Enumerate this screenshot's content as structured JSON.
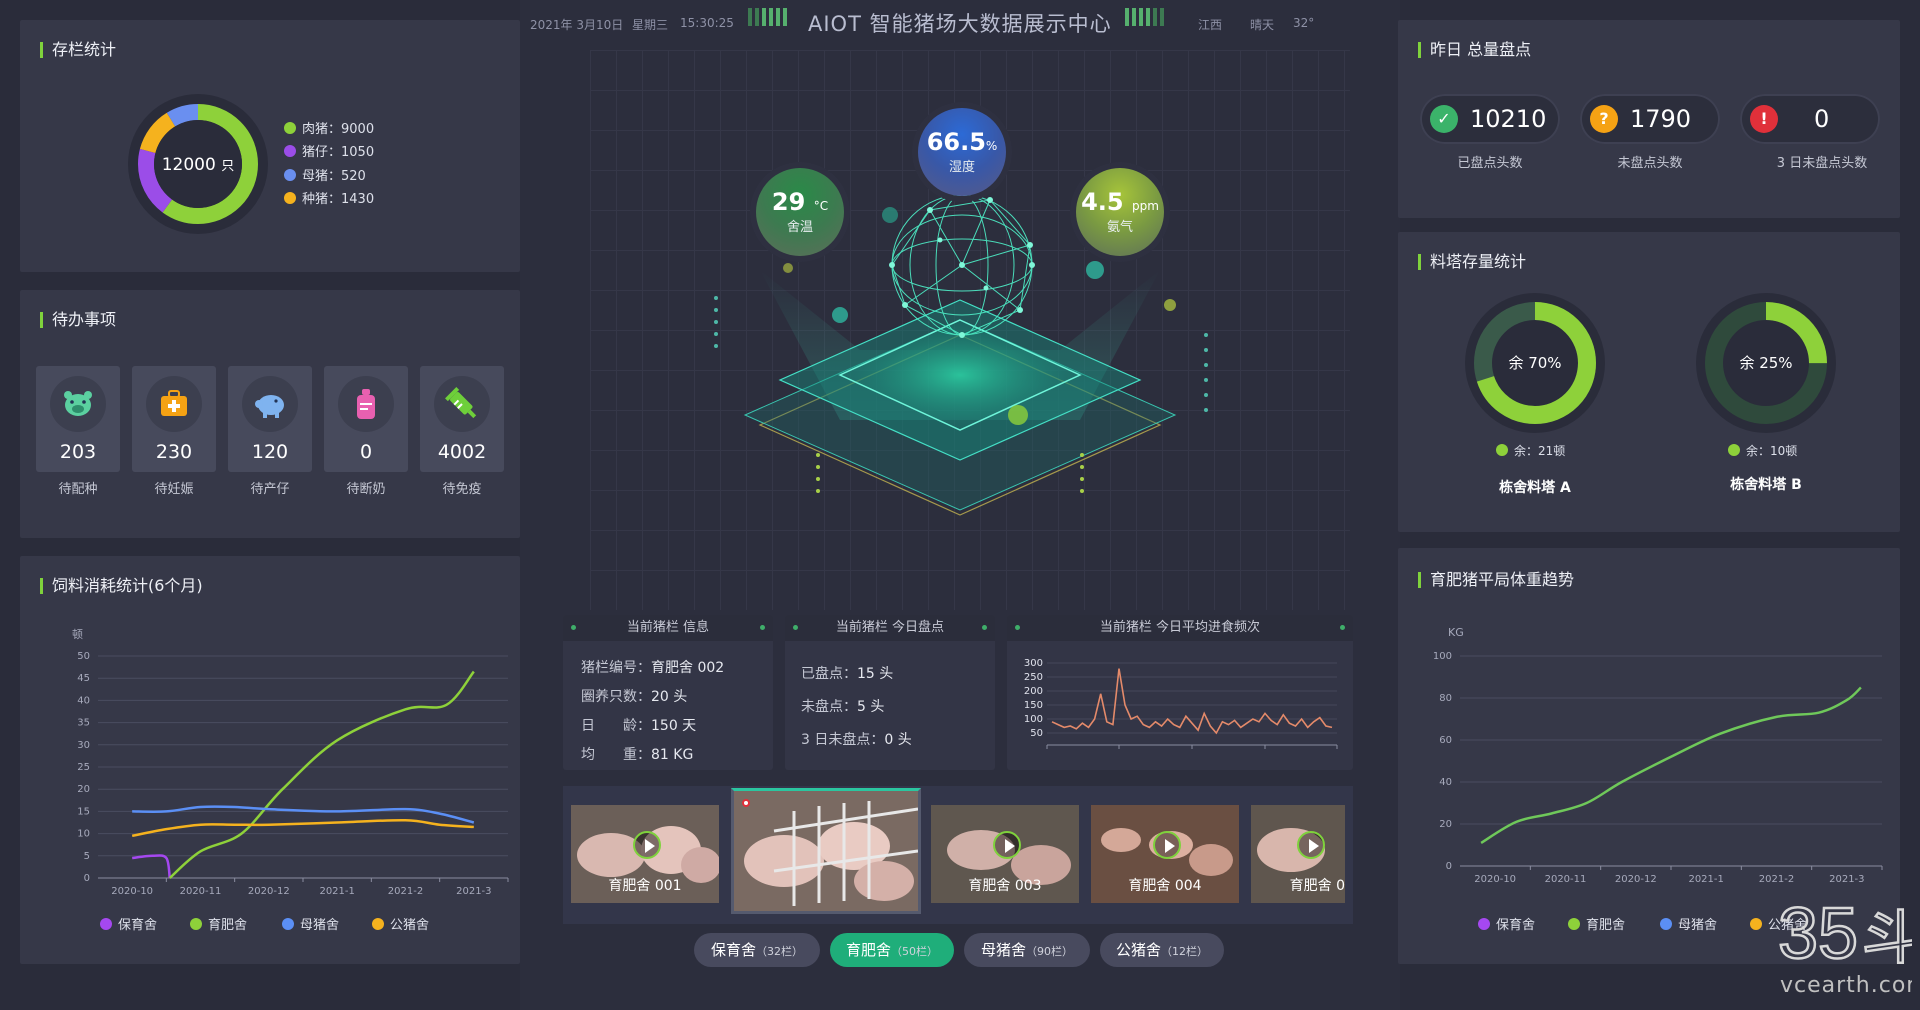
{
  "header": {
    "date": "2021年 3月10日",
    "weekday": "星期三",
    "time": "15:30:25",
    "title": "AIOT 智能猪场大数据展示中心",
    "location": "江西",
    "weather": "晴天",
    "temperature": "32°"
  },
  "inventory": {
    "title": "存栏统计",
    "total": "12000",
    "unit": "只",
    "items": [
      {
        "label": "肉猪：9000",
        "color": "#8ed13a"
      },
      {
        "label": "猪仔：1050",
        "color": "#9b4de8"
      },
      {
        "label": "母猪：520",
        "color": "#6a8ff0"
      },
      {
        "label": "种猪：1430",
        "color": "#f5b21e"
      }
    ]
  },
  "todo": {
    "title": "待办事项",
    "items": [
      {
        "value": "203",
        "label": "待配种",
        "icon": "pig-face-icon"
      },
      {
        "value": "230",
        "label": "待妊娠",
        "icon": "medical-kit-icon"
      },
      {
        "value": "120",
        "label": "待产仔",
        "icon": "piggy-icon"
      },
      {
        "value": "0",
        "label": "待断奶",
        "icon": "baby-bottle-icon"
      },
      {
        "value": "4002",
        "label": "待免疫",
        "icon": "syringe-icon"
      }
    ]
  },
  "feed_chart": {
    "title": "饲料消耗统计(6个月)",
    "unit": "顿",
    "legend": [
      {
        "label": "保育舍",
        "color": "#a548f0"
      },
      {
        "label": "育肥舍",
        "color": "#8ed13a"
      },
      {
        "label": "母猪舍",
        "color": "#5b8ff5"
      },
      {
        "label": "公猪舍",
        "color": "#f5b21e"
      }
    ]
  },
  "weight_chart": {
    "title": "育肥猪平局体重趋势",
    "unit": "KG",
    "legend": [
      {
        "label": "保育舍",
        "color": "#a548f0"
      },
      {
        "label": "育肥舍",
        "color": "#8ed13a"
      },
      {
        "label": "母猪舍",
        "color": "#5b8ff5"
      },
      {
        "label": "公猪舍",
        "color": "#f5b21e"
      }
    ]
  },
  "env": {
    "temp": {
      "value": "29",
      "unit": "°C",
      "label": "舍温"
    },
    "humidity": {
      "value": "66.5",
      "unit": "%",
      "label": "湿度"
    },
    "ammonia": {
      "value": "4.5",
      "unit": "ppm",
      "label": "氨气"
    }
  },
  "pen_info": {
    "title": "当前猪栏 信息",
    "rows": [
      {
        "k": "猪栏编号：",
        "v": "育肥舍 002"
      },
      {
        "k": "圈养只数：",
        "v": "20 头"
      },
      {
        "k": "日　　龄：",
        "v": "150 天"
      },
      {
        "k": "均　　重：",
        "v": "81 KG"
      }
    ]
  },
  "pen_count": {
    "title": "当前猪栏 今日盘点",
    "rows": [
      {
        "k": "已盘点：",
        "v": "15 头"
      },
      {
        "k": "未盘点：",
        "v": "5 头"
      },
      {
        "k": "3 日未盘点：",
        "v": "0 头"
      }
    ]
  },
  "feed_freq": {
    "title": "当前猪栏 今日平均进食频次",
    "y_ticks": [
      "300",
      "250",
      "200",
      "150",
      "100",
      "50"
    ]
  },
  "cameras": [
    {
      "label": "育肥舍 001",
      "selected": false
    },
    {
      "label": "",
      "selected": true
    },
    {
      "label": "育肥舍 003",
      "selected": false
    },
    {
      "label": "育肥舍 004",
      "selected": false
    },
    {
      "label": "育肥舍 0",
      "selected": false
    }
  ],
  "tabs": [
    {
      "name": "保育舍",
      "count": "（32栏）",
      "active": false
    },
    {
      "name": "育肥舍",
      "count": "（50栏）",
      "active": true
    },
    {
      "name": "母猪舍",
      "count": "（90栏）",
      "active": false
    },
    {
      "name": "公猪舍",
      "count": "（12栏）",
      "active": false
    }
  ],
  "total_count": {
    "title": "昨日 总量盘点",
    "items": [
      {
        "value": "10210",
        "label": "已盘点头数",
        "color": "#3bb36a",
        "icon": "check-icon",
        "glyph": "✓"
      },
      {
        "value": "1790",
        "label": "未盘点头数",
        "color": "#f5a214",
        "icon": "question-icon",
        "glyph": "?"
      },
      {
        "value": "0",
        "label": "3 日未盘点头数",
        "color": "#e0303a",
        "icon": "warning-icon",
        "glyph": "!"
      }
    ]
  },
  "silo": {
    "title": "料塔存量统计",
    "items": [
      {
        "pct_label": "余 70%",
        "fraction": 0.7,
        "remain": "余：21顿",
        "name": "栋舍料塔 A"
      },
      {
        "pct_label": "余 25%",
        "fraction": 0.25,
        "remain": "余：10顿",
        "name": "栋舍料塔 B"
      }
    ]
  },
  "chart_data": [
    {
      "type": "line",
      "title": "饲料消耗统计(6个月)",
      "ylabel": "顿",
      "x": [
        "2020-10",
        "2020-11",
        "2020-12",
        "2021-1",
        "2021-2",
        "2021-3"
      ],
      "ylim": [
        0,
        50
      ],
      "yticks": [
        0,
        5,
        10,
        15,
        20,
        25,
        30,
        35,
        40,
        45,
        50
      ],
      "series": [
        {
          "name": "保育舍",
          "color": "#a548f0",
          "points": [
            [
              0,
              4.5
            ],
            [
              0.3,
              5
            ],
            [
              0.5,
              4.5
            ],
            [
              0.55,
              0
            ]
          ]
        },
        {
          "name": "育肥舍",
          "color": "#8ed13a",
          "points": [
            [
              0.55,
              0
            ],
            [
              1,
              6
            ],
            [
              1.6,
              10
            ],
            [
              2.2,
              20
            ],
            [
              3,
              31
            ],
            [
              4,
              38
            ],
            [
              4.6,
              39
            ],
            [
              5,
              46.5
            ]
          ]
        },
        {
          "name": "母猪舍",
          "color": "#5b8ff5",
          "points": [
            [
              0,
              15
            ],
            [
              0.5,
              15
            ],
            [
              1,
              16
            ],
            [
              1.5,
              16
            ],
            [
              2,
              15.5
            ],
            [
              3,
              15
            ],
            [
              4,
              15.5
            ],
            [
              4.5,
              14.5
            ],
            [
              5,
              12.5
            ]
          ]
        },
        {
          "name": "公猪舍",
          "color": "#f5b21e",
          "points": [
            [
              0,
              9.5
            ],
            [
              0.5,
              11
            ],
            [
              1,
              12
            ],
            [
              1.5,
              12
            ],
            [
              2,
              12
            ],
            [
              3,
              12.5
            ],
            [
              4,
              13
            ],
            [
              4.5,
              12
            ],
            [
              5,
              11.5
            ]
          ]
        }
      ]
    },
    {
      "type": "line",
      "title": "育肥猪平局体重趋势",
      "ylabel": "KG",
      "x": [
        "2020-10",
        "2020-11",
        "2020-12",
        "2021-1",
        "2021-2",
        "2021-3"
      ],
      "ylim": [
        0,
        100
      ],
      "yticks": [
        0,
        20,
        40,
        60,
        80,
        100
      ],
      "series": [
        {
          "name": "育肥舍",
          "color": "#6fc85a",
          "points": [
            [
              -0.2,
              11
            ],
            [
              0.3,
              21
            ],
            [
              0.8,
              25
            ],
            [
              1.3,
              30
            ],
            [
              1.8,
              40
            ],
            [
              2.5,
              52
            ],
            [
              3.2,
              63
            ],
            [
              4,
              71
            ],
            [
              4.6,
              73
            ],
            [
              5,
              79
            ],
            [
              5.2,
              85
            ]
          ]
        }
      ]
    },
    {
      "type": "line",
      "title": "当前猪栏 今日平均进食频次",
      "ylim": [
        50,
        300
      ],
      "yticks": [
        50,
        100,
        150,
        200,
        250,
        300
      ],
      "series": [
        {
          "name": "",
          "color": "#e48a6a",
          "values": [
            90,
            80,
            70,
            75,
            65,
            85,
            70,
            100,
            190,
            90,
            80,
            280,
            150,
            100,
            110,
            80,
            70,
            90,
            75,
            100,
            80,
            70,
            110,
            85,
            60,
            120,
            75,
            50,
            90,
            80,
            95,
            70,
            85,
            100,
            90,
            120,
            95,
            80,
            115,
            85,
            75,
            100,
            70,
            90,
            105,
            75,
            70
          ]
        }
      ]
    }
  ]
}
